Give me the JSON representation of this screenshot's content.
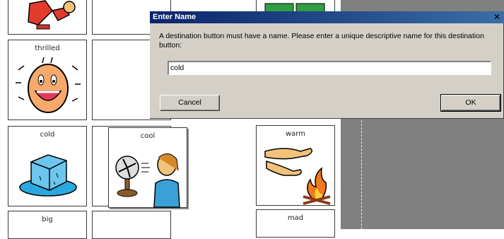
{
  "dialog": {
    "title": "Enter Name",
    "close_glyph": "✕",
    "message": "A destination button must have a name.  Please enter a unique descriptive name for this destination button:",
    "input_value": "cold",
    "cancel_label": "Cancel",
    "ok_label": "OK"
  },
  "board": {
    "cells": {
      "thrilled": "thrilled",
      "cold": "cold",
      "cool": "cool",
      "warm": "warm",
      "big": "big",
      "mad": "mad"
    }
  },
  "colors": {
    "titlebar_start": "#0a246a",
    "titlebar_end": "#3a6ea5",
    "dialog_bg": "#d4d0c8",
    "workspace_gray": "#808080"
  }
}
